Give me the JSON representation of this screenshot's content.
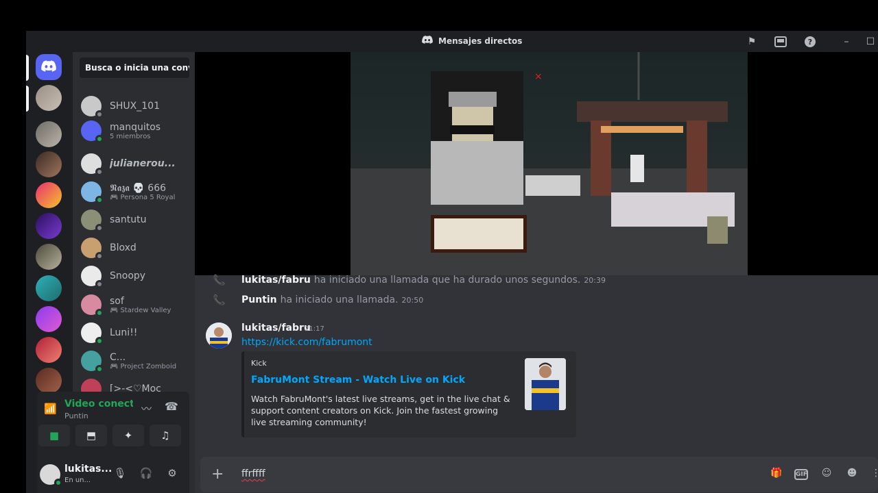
{
  "window": {
    "title": "Mensajes directos",
    "icons": [
      "discord-logo-icon",
      "flag-icon",
      "inbox-icon",
      "help-icon",
      "minimize-icon",
      "maximize-icon"
    ]
  },
  "sidebar": {
    "search_placeholder": "Busca o inicia una conv...",
    "dms": [
      {
        "name": "SHUX_101",
        "sub": "",
        "status": "offline"
      },
      {
        "name": "manquitos",
        "sub": "5 miembros",
        "status": "group"
      },
      {
        "name": "julianerou...",
        "sub": "",
        "status": "offline"
      },
      {
        "name": "𝕹𝖆𝖟𝖆 💀 666",
        "sub": "Persona 5 Royal",
        "status": "online",
        "gaming": true
      },
      {
        "name": "santutu",
        "sub": "",
        "status": "offline"
      },
      {
        "name": "Bloxd",
        "sub": "",
        "status": "offline"
      },
      {
        "name": "Snoopy",
        "sub": "",
        "status": "offline"
      },
      {
        "name": "sof",
        "sub": "Stardew Valley",
        "status": "online",
        "gaming": true
      },
      {
        "name": "Luni!!",
        "sub": "",
        "status": "online"
      },
      {
        "name": "C...",
        "sub": "Project Zomboid",
        "status": "online",
        "gaming": true
      },
      {
        "name": "[>-<♡Moc",
        "sub": "",
        "status": "offline"
      }
    ]
  },
  "voice": {
    "status": "Video conectado",
    "channel": "Puntin",
    "buttons": [
      "camera-icon",
      "screen-share-icon",
      "activities-icon",
      "soundboard-icon"
    ]
  },
  "user": {
    "name": "lukitas...",
    "status": "En un..."
  },
  "messages": {
    "system": [
      {
        "author": "lukitas/fabru",
        "text": "ha iniciado una llamada que ha durado unos segundos.",
        "time": "20:39"
      },
      {
        "author": "Puntin",
        "text": "ha iniciado una llamada.",
        "time": "20:50"
      }
    ],
    "post": {
      "author": "lukitas/fabru",
      "time": "21:17",
      "link": "https://kick.com/fabrumont",
      "embed": {
        "provider": "Kick",
        "title": "FabruMont Stream - Watch Live on Kick",
        "description": "Watch FabruMont's latest live streams, get in the live chat & support content creators on Kick. Join the fastest growing live streaming community!"
      }
    }
  },
  "composer": {
    "value": "ffrffff",
    "icons": [
      "gift-icon",
      "gif-icon",
      "sticker-icon",
      "emoji-icon"
    ]
  },
  "colors": {
    "bg": "#313338",
    "sidebar": "#2b2d31",
    "rail": "#1e1f22",
    "accent": "#5865f2",
    "online": "#23a55a",
    "link": "#00a8fc"
  }
}
